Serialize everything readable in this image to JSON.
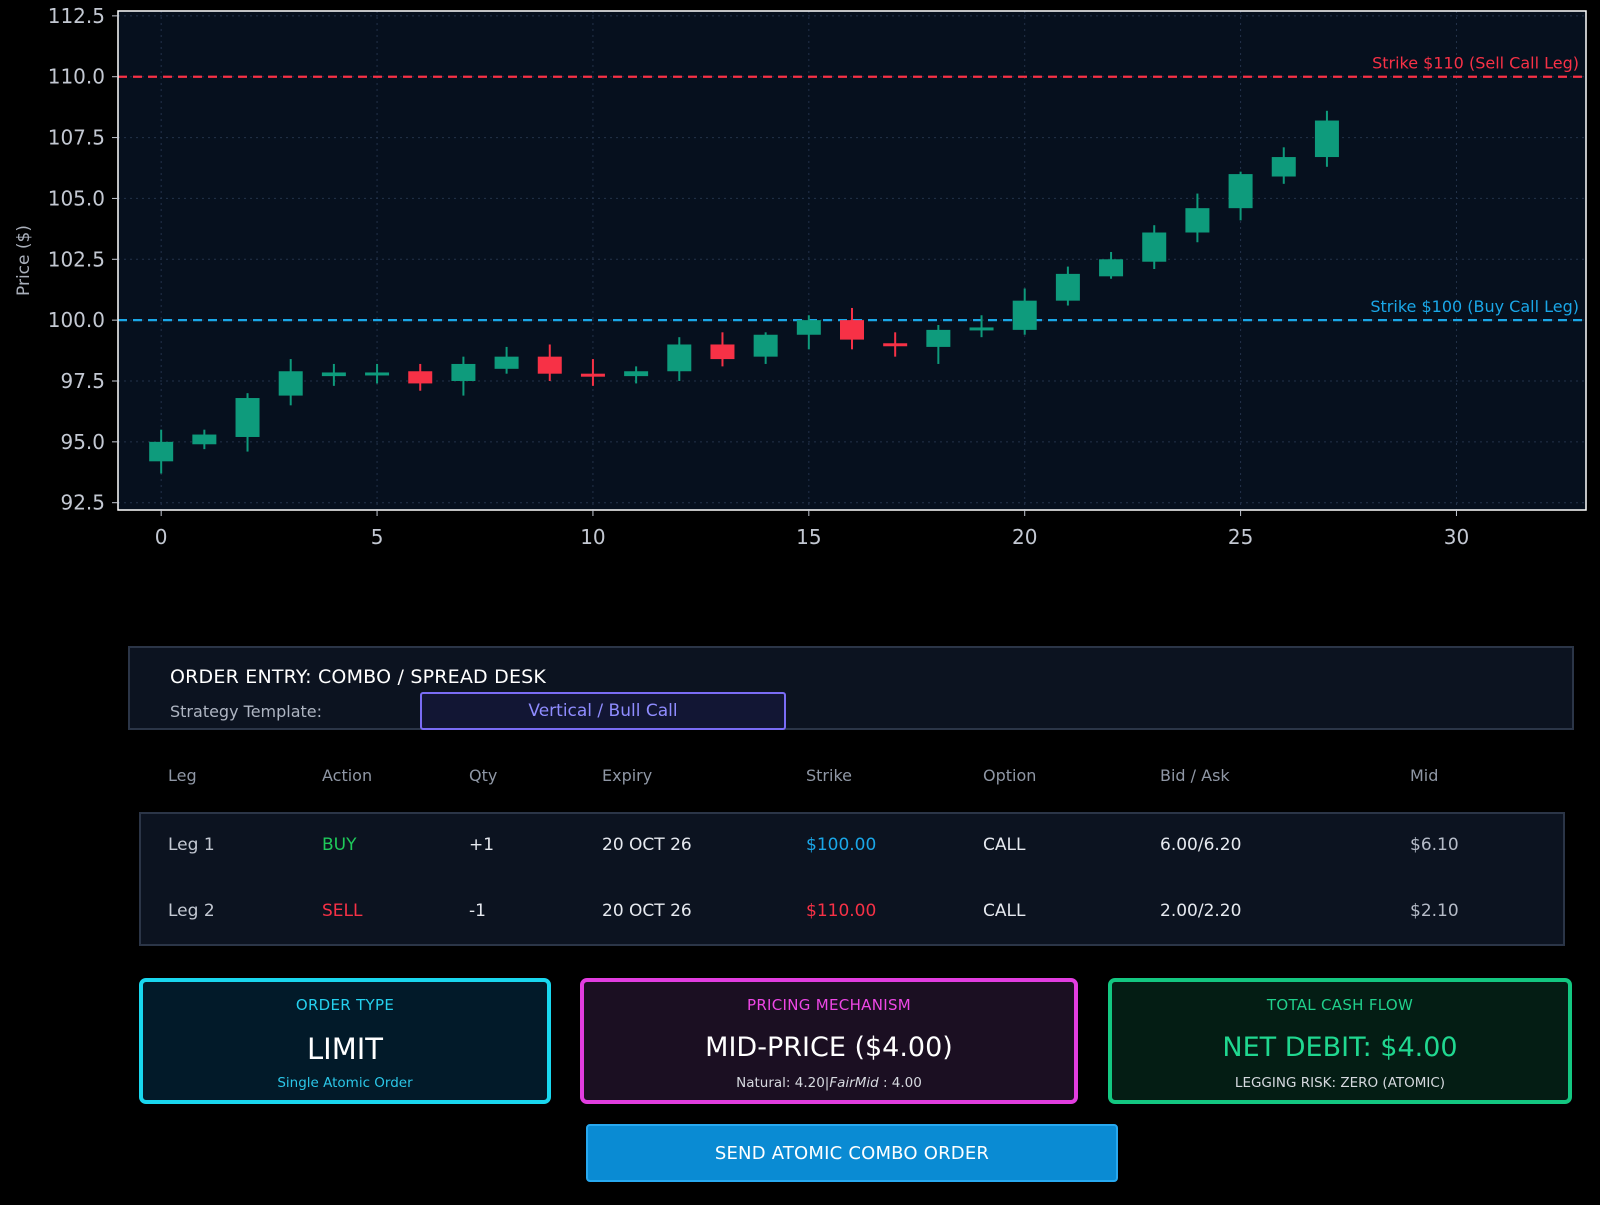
{
  "chart_data": {
    "type": "candlestick",
    "ylabel": "Price ($)",
    "xlabel": "",
    "xlim": [
      -1,
      33
    ],
    "ylim": [
      92.2,
      112.7
    ],
    "x_ticks": [
      0,
      5,
      10,
      15,
      20,
      25,
      30
    ],
    "y_ticks": [
      92.5,
      95.0,
      97.5,
      100.0,
      102.5,
      105.0,
      107.5,
      110.0,
      112.5
    ],
    "grid": true,
    "colors": {
      "up": "#0e9b7c",
      "down": "#f73146",
      "background": "#06101e",
      "frame": "#ffffff"
    },
    "candles": [
      {
        "x": 0,
        "open": 94.2,
        "high": 95.5,
        "low": 93.7,
        "close": 95.0
      },
      {
        "x": 1,
        "open": 94.9,
        "high": 95.5,
        "low": 94.7,
        "close": 95.3
      },
      {
        "x": 2,
        "open": 95.2,
        "high": 97.0,
        "low": 94.6,
        "close": 96.8
      },
      {
        "x": 3,
        "open": 96.9,
        "high": 98.4,
        "low": 96.5,
        "close": 97.9
      },
      {
        "x": 4,
        "open": 97.7,
        "high": 98.2,
        "low": 97.3,
        "close": 97.85
      },
      {
        "x": 5,
        "open": 97.75,
        "high": 98.2,
        "low": 97.4,
        "close": 97.85
      },
      {
        "x": 6,
        "open": 97.9,
        "high": 98.2,
        "low": 97.1,
        "close": 97.4
      },
      {
        "x": 7,
        "open": 97.5,
        "high": 98.5,
        "low": 96.9,
        "close": 98.2
      },
      {
        "x": 8,
        "open": 98.0,
        "high": 98.9,
        "low": 97.8,
        "close": 98.5
      },
      {
        "x": 9,
        "open": 98.5,
        "high": 99.0,
        "low": 97.5,
        "close": 97.8
      },
      {
        "x": 10,
        "open": 97.8,
        "high": 98.4,
        "low": 97.3,
        "close": 97.7
      },
      {
        "x": 11,
        "open": 97.7,
        "high": 98.1,
        "low": 97.4,
        "close": 97.9
      },
      {
        "x": 12,
        "open": 97.9,
        "high": 99.3,
        "low": 97.5,
        "close": 99.0
      },
      {
        "x": 13,
        "open": 99.0,
        "high": 99.5,
        "low": 98.1,
        "close": 98.4
      },
      {
        "x": 14,
        "open": 98.5,
        "high": 99.5,
        "low": 98.2,
        "close": 99.4
      },
      {
        "x": 15,
        "open": 99.4,
        "high": 100.2,
        "low": 98.8,
        "close": 100.0
      },
      {
        "x": 16,
        "open": 100.0,
        "high": 100.5,
        "low": 98.8,
        "close": 99.2
      },
      {
        "x": 17,
        "open": 99.05,
        "high": 99.5,
        "low": 98.5,
        "close": 98.95
      },
      {
        "x": 18,
        "open": 98.9,
        "high": 99.8,
        "low": 98.2,
        "close": 99.6
      },
      {
        "x": 19,
        "open": 99.6,
        "high": 100.2,
        "low": 99.3,
        "close": 99.7
      },
      {
        "x": 20,
        "open": 99.6,
        "high": 101.3,
        "low": 99.4,
        "close": 100.8
      },
      {
        "x": 21,
        "open": 100.8,
        "high": 102.2,
        "low": 100.6,
        "close": 101.9
      },
      {
        "x": 22,
        "open": 101.8,
        "high": 102.8,
        "low": 101.7,
        "close": 102.5
      },
      {
        "x": 23,
        "open": 102.4,
        "high": 103.9,
        "low": 102.1,
        "close": 103.6
      },
      {
        "x": 24,
        "open": 103.6,
        "high": 105.2,
        "low": 103.2,
        "close": 104.6
      },
      {
        "x": 25,
        "open": 104.6,
        "high": 106.1,
        "low": 104.1,
        "close": 106.0
      },
      {
        "x": 26,
        "open": 105.9,
        "high": 107.1,
        "low": 105.6,
        "close": 106.7
      },
      {
        "x": 27,
        "open": 106.7,
        "high": 108.6,
        "low": 106.3,
        "close": 108.2
      }
    ],
    "hlines": [
      {
        "y": 110.0,
        "label": "Strike $110 (Sell Call Leg)",
        "color": "#f73146"
      },
      {
        "y": 100.0,
        "label": "Strike $100 (Buy Call Leg)",
        "color": "#1aa7e8"
      }
    ]
  },
  "order_entry": {
    "title": "ORDER ENTRY: COMBO / SPREAD DESK",
    "strategy_label": "Strategy Template:",
    "strategy_value": "Vertical / Bull Call"
  },
  "legs": {
    "headers": {
      "leg": "Leg",
      "action": "Action",
      "qty": "Qty",
      "expiry": "Expiry",
      "strike": "Strike",
      "option": "Option",
      "bid_ask": "Bid / Ask",
      "mid": "Mid"
    },
    "rows": [
      {
        "leg": "Leg 1",
        "action": "BUY",
        "action_color": "#1fc95a",
        "qty": "+1",
        "expiry": "20 OCT 26",
        "strike": "$100.00",
        "strike_color": "#1aa7e8",
        "option": "CALL",
        "bid_ask": "6.00/6.20",
        "mid": "$6.10"
      },
      {
        "leg": "Leg 2",
        "action": "SELL",
        "action_color": "#f73146",
        "qty": "-1",
        "expiry": "20 OCT 26",
        "strike": "$110.00",
        "strike_color": "#f73146",
        "option": "CALL",
        "bid_ask": "2.00/2.20",
        "mid": "$2.10"
      }
    ]
  },
  "cards": {
    "order_type": {
      "title": "ORDER TYPE",
      "value": "LIMIT",
      "sub": "Single Atomic Order"
    },
    "pricing": {
      "title": "PRICING MECHANISM",
      "value": "MID-PRICE ($4.00)",
      "sub_pre": "Natural: 4.20|",
      "sub_em": "FairMid",
      "sub_post": " : 4.00"
    },
    "cash_flow": {
      "title": "TOTAL CASH FLOW",
      "value": "NET DEBIT: $4.00",
      "sub": "LEGGING RISK: ZERO (ATOMIC)"
    }
  },
  "send_button": {
    "label": "SEND ATOMIC COMBO ORDER"
  }
}
